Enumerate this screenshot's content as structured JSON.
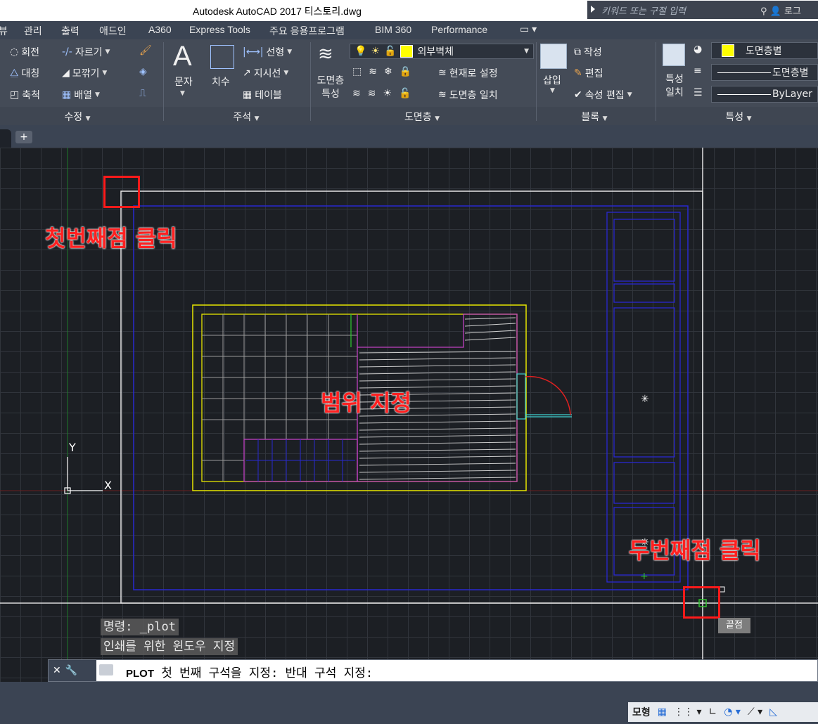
{
  "window": {
    "title": "Autodesk AutoCAD 2017    티스토리.dwg",
    "search_placeholder": "키워드 또는 구절 입력",
    "user_label": "로그"
  },
  "ribbon_tabs": [
    "뷰",
    "관리",
    "출력",
    "애드인",
    "A360",
    "Express Tools",
    "주요 응용프로그램",
    "BIM 360",
    "Performance"
  ],
  "modify_panel": {
    "title": "수정",
    "items": [
      "회전",
      "자르기",
      "대칭",
      "모깎기",
      "축척",
      "배열"
    ]
  },
  "annotation_panel": {
    "title": "주석",
    "large": [
      "문자",
      "치수"
    ],
    "items": [
      "선형",
      "지시선",
      "테이블"
    ]
  },
  "layers_panel": {
    "title": "도면층",
    "large": "도면층 특성",
    "current_layer": "외부벽체",
    "layer_color": "#ffff00",
    "items": [
      "현재로 설정",
      "도면층 일치"
    ]
  },
  "block_panel": {
    "title": "블록",
    "large": "삽입",
    "items": [
      "작성",
      "편집",
      "속성 편집"
    ]
  },
  "properties_panel": {
    "title": "특성",
    "large": "특성 일치",
    "color_value": "도면층별",
    "linetype_value": "도면층별",
    "lineweight_value": "ByLayer"
  },
  "annotations": {
    "first_point": "첫번째점 클릭",
    "range": "범위 지정",
    "second_point": "두번째점 클릭"
  },
  "osnap_tooltip": "끝점",
  "ucs": {
    "x": "X",
    "y": "Y"
  },
  "command_history": [
    "명령: _plot",
    "인쇄를 위한 윈도우 지정"
  ],
  "command_line": {
    "command": "PLOT",
    "prompt": "첫 번째 구석을 지정: 반대 구석 지정:"
  },
  "statusbar": {
    "model": "모형"
  }
}
